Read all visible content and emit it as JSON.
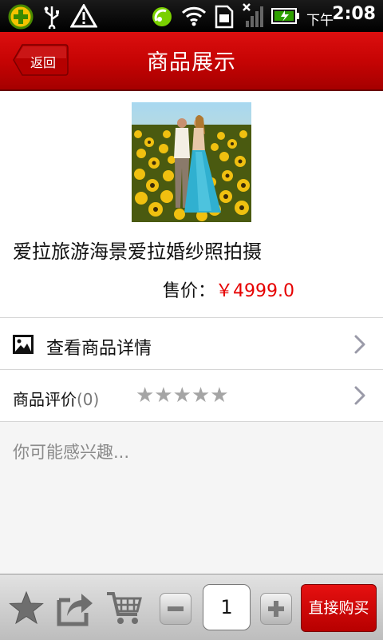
{
  "status_bar": {
    "time_prefix": "下午",
    "time": "2:08",
    "icons": [
      "app-plus-icon",
      "usb-icon",
      "warning-icon",
      "sync-icon",
      "wifi-icon",
      "sim-icon",
      "signal-icon",
      "battery-icon"
    ]
  },
  "header": {
    "back_label": "返回",
    "title": "商品展示"
  },
  "product": {
    "name": "爱拉旅游海景爱拉婚纱照拍摄",
    "price_label": "售价：",
    "price": "￥4999.0"
  },
  "rows": {
    "details_label": "查看商品详情",
    "reviews_label": "商品评价",
    "reviews_count": "(0)",
    "rating_stars": "★★★★★",
    "rating": 0
  },
  "interest_text": "你可能感兴趣...",
  "toolbar": {
    "icons": [
      "star-icon",
      "share-icon",
      "cart-icon",
      "minus-icon",
      "plus-icon"
    ],
    "quantity": "1",
    "buy_label": "直接购买"
  },
  "colors": {
    "header_red": "#c60404",
    "price_red": "#e60000",
    "buy_button": "#d30707"
  }
}
